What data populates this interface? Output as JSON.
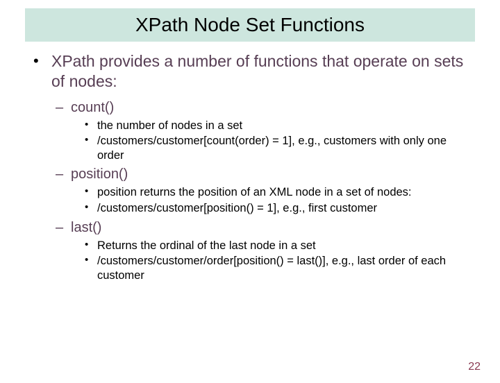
{
  "title": "XPath Node Set Functions",
  "intro": "XPath provides a number of functions that operate on sets of nodes:",
  "functions": [
    {
      "name": "count()",
      "points": [
        "the number of nodes in a set",
        "/customers/customer[count(order) = 1], e.g., customers with only one order"
      ]
    },
    {
      "name": "position()",
      "points": [
        "position returns the position of an XML node in a set of nodes:",
        "/customers/customer[position() = 1], e.g., first customer"
      ]
    },
    {
      "name": "last()",
      "points": [
        "Returns the ordinal of the last node in a set",
        "/customers/customer/order[position() = last()], e.g., last order of each customer"
      ]
    }
  ],
  "page_number": "22"
}
